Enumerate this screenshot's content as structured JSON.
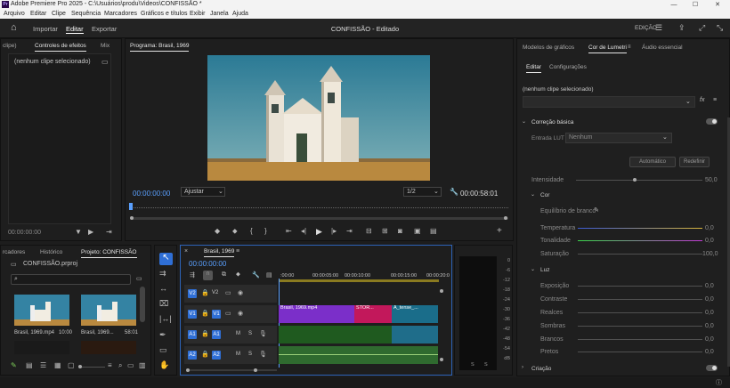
{
  "app": {
    "title": "Adobe Premiere Pro 2025 - C:\\Usuários\\produ\\Videos\\CONFISSÃO *",
    "icon_text": "Pr",
    "brand_color": "#9999ff"
  },
  "menu": [
    "Arquivo",
    "Editar",
    "Clipe",
    "Sequência",
    "Marcadores",
    "Gráficos e títulos",
    "Exibir",
    "Janela",
    "Ajuda"
  ],
  "header": {
    "home": "home-icon",
    "tabs": [
      "Importar",
      "Editar",
      "Exportar"
    ],
    "project_title": "CONFISSÃO - Editado",
    "workspace": "EDIÇÃO"
  },
  "effects_panel": {
    "tabs": [
      "clipe)",
      "Controles de efeitos",
      "Mix"
    ],
    "no_clip": "(nenhum clipe selecionado)",
    "timecode": "00:00:00:00"
  },
  "program": {
    "title": "Programa: Brasil, 1969",
    "timecode": "00:00:00:00",
    "fit": "Ajustar",
    "resolution": "1/2",
    "duration": "00:00:58:01"
  },
  "project_panel": {
    "tabs": [
      "rcadores",
      "Histórico",
      "Projeto: CONFISSÃO"
    ],
    "file": "CONFISSÃO.prproj",
    "items": [
      {
        "name": "Brasil, 1969.mp4",
        "dur": "10:00"
      },
      {
        "name": "Brasil, 1969...",
        "dur": "58:01"
      }
    ]
  },
  "timeline": {
    "title": "Brasil, 1969",
    "timecode": "00:00:00:00",
    "ruler": [
      ":00:00",
      "00:00:05:00",
      "00:00:10:00",
      "00:00:15:00",
      "00:00:20:0"
    ],
    "tracks": [
      {
        "id": "V2",
        "src": "V2"
      },
      {
        "id": "V1",
        "src": "V1"
      },
      {
        "id": "A1",
        "src": "A1",
        "m": "M",
        "s": "S"
      },
      {
        "id": "A2",
        "src": "A2",
        "m": "M",
        "s": "S"
      }
    ],
    "clips": [
      {
        "label": "Brasil, 1969.mp4",
        "color": "#7b2fc9"
      },
      {
        "label": "STOR...",
        "color": "#c2185b"
      },
      {
        "label": "A_tense_...",
        "color": "#1a6d8a"
      }
    ]
  },
  "meter": {
    "scale": [
      "0",
      "-6",
      "-12",
      "-18",
      "-24",
      "-30",
      "-36",
      "-42",
      "-48",
      "-54",
      "dB"
    ],
    "labels": [
      "S",
      "S"
    ]
  },
  "lumetri": {
    "tabs": [
      "Modelos de gráficos",
      "Cor de Lumetri",
      "Áudio essencial"
    ],
    "subtabs": [
      "Editar",
      "Configurações"
    ],
    "no_clip": "(nenhum clipe selecionado)",
    "section_basic": "Correção básica",
    "lut_label": "Entrada LUT",
    "lut_value": "Nenhum",
    "auto": "Automático",
    "reset": "Redefinir",
    "intensity": {
      "label": "Intensidade",
      "value": "50,0"
    },
    "color_section": "Cor",
    "wb": "Equilíbrio de branco",
    "color_params": [
      {
        "label": "Temperatura",
        "value": "0,0"
      },
      {
        "label": "Tonalidade",
        "value": "0,0"
      },
      {
        "label": "Saturação",
        "value": "100,0"
      }
    ],
    "light_section": "Luz",
    "light_params": [
      {
        "label": "Exposição",
        "value": "0,0"
      },
      {
        "label": "Contraste",
        "value": "0,0"
      },
      {
        "label": "Realces",
        "value": "0,0"
      },
      {
        "label": "Sombras",
        "value": "0,0"
      },
      {
        "label": "Brancos",
        "value": "0,0"
      },
      {
        "label": "Pretos",
        "value": "0,0"
      }
    ],
    "creative": "Criação"
  }
}
